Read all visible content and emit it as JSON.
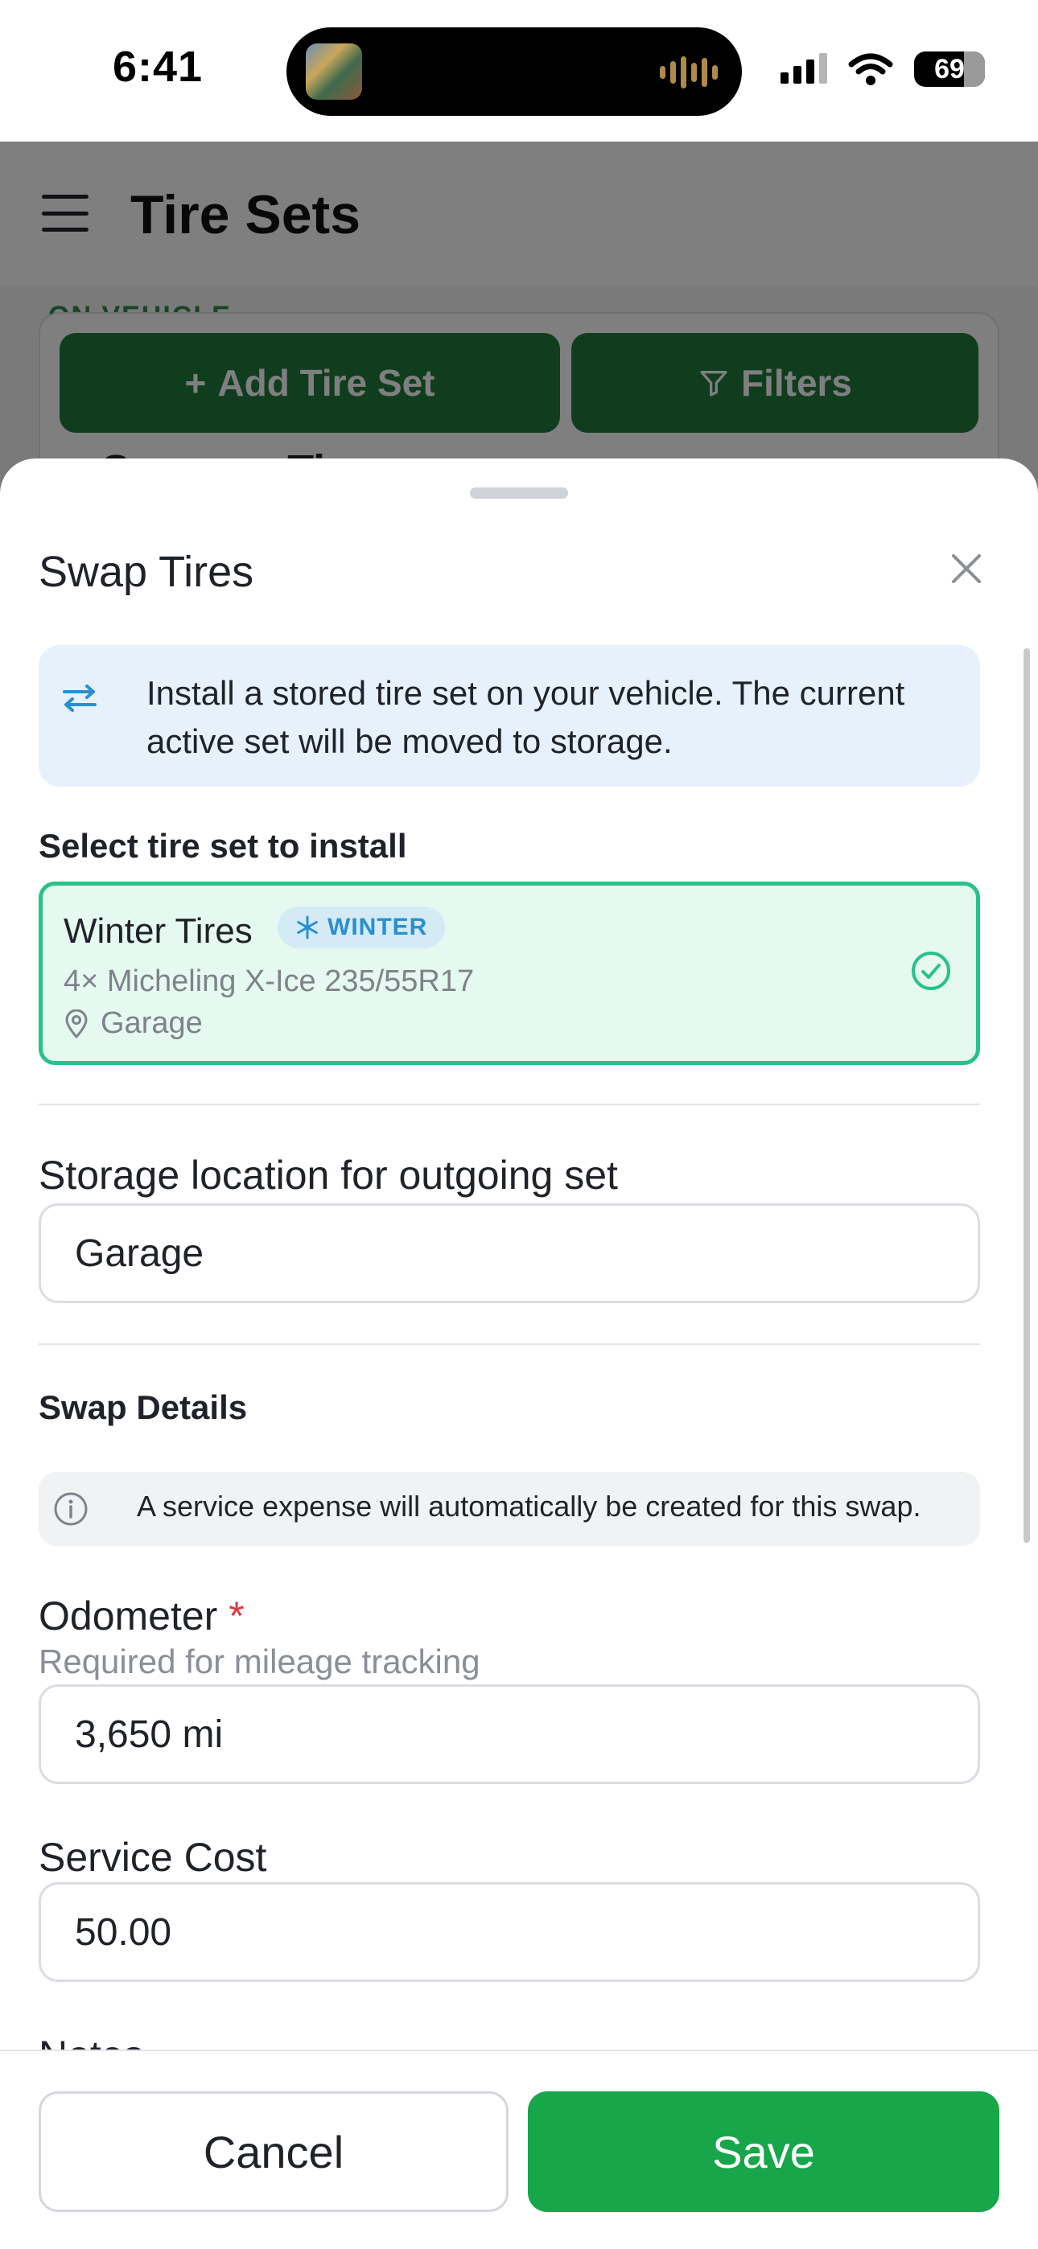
{
  "status_bar": {
    "time": "6:41",
    "battery": "69",
    "icons": [
      "album-art-icon",
      "audio-waveform-icon",
      "cellular-signal-icon",
      "wifi-icon",
      "battery-icon"
    ]
  },
  "header": {
    "title": "Tire Sets",
    "menu_icon": "hamburger-menu-icon"
  },
  "background": {
    "chip": "ON VEHICLE",
    "add_button": "Add Tire Set",
    "filters_button": "Filters",
    "partial_title": "Summer Tires"
  },
  "sheet": {
    "title": "Swap Tires",
    "info_text": "Install a stored tire set on your vehicle. The current active set will be moved to storage.",
    "select_label": "Select tire set to install",
    "selected_set": {
      "name": "Winter Tires",
      "season": "WINTER",
      "spec": "4× Micheling X-Ice 235/55R17",
      "location": "Garage"
    },
    "storage_label": "Storage location for outgoing set",
    "storage_value": "Garage",
    "swap_details_label": "Swap Details",
    "expense_note": "A service expense will automatically be created for this swap.",
    "odometer_label": "Odometer",
    "odometer_required": "*",
    "odometer_helper": "Required for mileage tracking",
    "odometer_value": "3,650 mi",
    "service_cost_label": "Service Cost",
    "service_cost_value": "50.00",
    "notes_label": "Notes"
  },
  "footer": {
    "cancel": "Cancel",
    "save": "Save"
  },
  "colors": {
    "primary_green": "#17a64a",
    "selected_border": "#27c287",
    "selected_bg": "#e6f9f1",
    "info_bg": "#e7f1fb",
    "winter_badge": "#2a8fcf"
  }
}
